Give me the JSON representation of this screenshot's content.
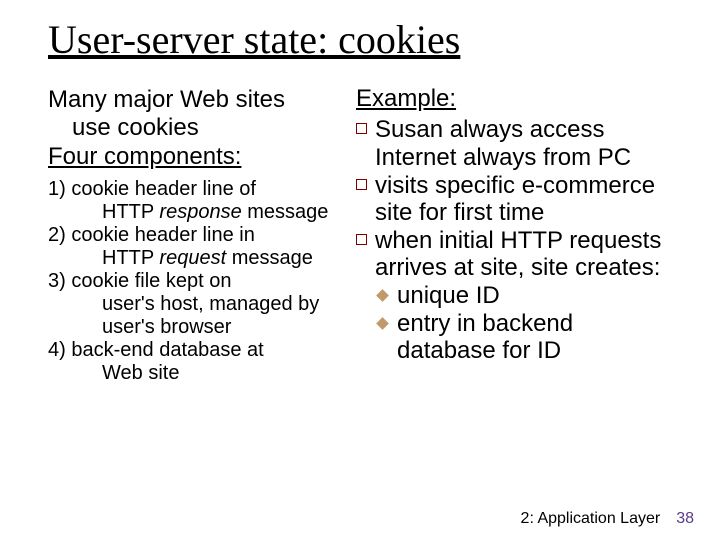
{
  "title": "User-server state: cookies",
  "left": {
    "intro_line1": "Many major Web sites",
    "intro_line2": "use cookies",
    "subhead": "Four components:",
    "items": [
      {
        "num": "1)",
        "t1": "cookie header line of",
        "t2": "HTTP ",
        "em": "response",
        "t3": " message"
      },
      {
        "num": "2)",
        "t1": "cookie header line in",
        "t2": "HTTP ",
        "em": "request",
        "t3": " message"
      },
      {
        "num": "3)",
        "t1": "cookie file kept on",
        "t2a": "user's host, managed by",
        "t2b": "user's browser"
      },
      {
        "num": "4)",
        "t1": "back-end database at",
        "t2a": "Web site"
      }
    ]
  },
  "right": {
    "subhead": "Example:",
    "bullets": [
      "Susan always access Internet always from PC",
      "visits specific e-commerce site for first time",
      "when initial HTTP requests arrives at site, site creates:"
    ],
    "subbullets": [
      "unique ID",
      "entry in backend database for ID"
    ]
  },
  "footer": {
    "chapter": "2: Application Layer",
    "page": "38"
  }
}
